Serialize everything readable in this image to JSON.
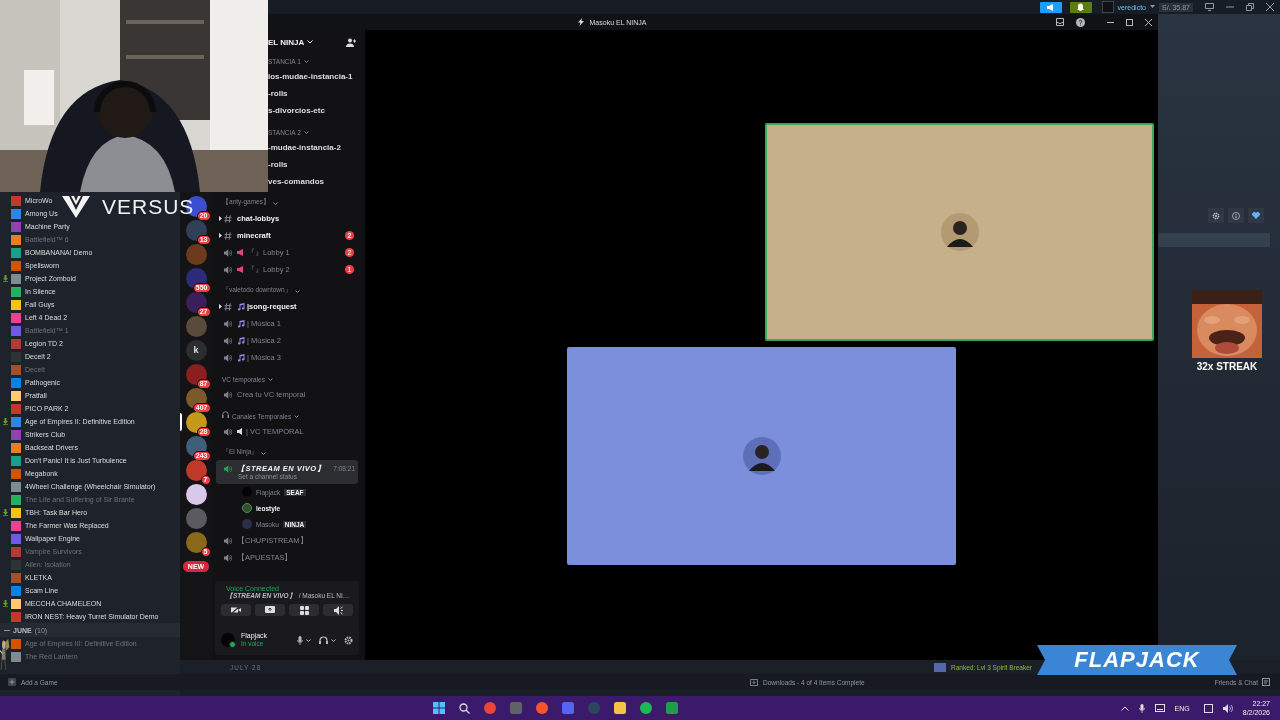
{
  "steam_top": {
    "username": "veredicto",
    "balance": "S/. 35.87"
  },
  "library": {
    "games": [
      {
        "name": "MicroWo",
        "installed": true,
        "update": false
      },
      {
        "name": "Among Us",
        "installed": true,
        "update": false
      },
      {
        "name": "Machine Party",
        "installed": true,
        "update": false
      },
      {
        "name": "Battlefield™ 6",
        "installed": false,
        "update": false
      },
      {
        "name": "BOMBANANA! Demo",
        "installed": true,
        "update": false
      },
      {
        "name": "Spellsworn",
        "installed": true,
        "update": false
      },
      {
        "name": "Project Zomboid",
        "installed": true,
        "update": true
      },
      {
        "name": "In Silence",
        "installed": true,
        "update": false
      },
      {
        "name": "Fall Guys",
        "installed": true,
        "update": false
      },
      {
        "name": "Left 4 Dead 2",
        "installed": true,
        "update": false
      },
      {
        "name": "Battlefield™ 1",
        "installed": false,
        "update": false
      },
      {
        "name": "Legion TD 2",
        "installed": true,
        "update": false
      },
      {
        "name": "Deceit 2",
        "installed": true,
        "update": false
      },
      {
        "name": "Deceit",
        "installed": false,
        "update": false
      },
      {
        "name": "Pathogenic",
        "installed": true,
        "update": false
      },
      {
        "name": "Pratfall",
        "installed": true,
        "update": false
      },
      {
        "name": "PICO PARK 2",
        "installed": true,
        "update": false
      },
      {
        "name": "Age of Empires II: Definitive Edition",
        "installed": true,
        "update": true
      },
      {
        "name": "Strikers Club",
        "installed": true,
        "update": false
      },
      {
        "name": "Backseat Drivers",
        "installed": true,
        "update": false
      },
      {
        "name": "Don't Panic! It is Just Turbulence",
        "installed": true,
        "update": false
      },
      {
        "name": "Megabonk",
        "installed": true,
        "update": false
      },
      {
        "name": "4Wheel Challenge (Wheelchair Simulator)",
        "installed": true,
        "update": false
      },
      {
        "name": "The Life and Suffering of Sir Brante",
        "installed": false,
        "update": false
      },
      {
        "name": "TBH: Task Bar Hero",
        "installed": true,
        "update": true
      },
      {
        "name": "The Farmer Was Replaced",
        "installed": true,
        "update": false
      },
      {
        "name": "Wallpaper Engine",
        "installed": true,
        "update": false
      },
      {
        "name": "Vampire Survivors",
        "installed": false,
        "update": false
      },
      {
        "name": "Alien: Isolation",
        "installed": false,
        "update": false
      },
      {
        "name": "KLETKA",
        "installed": true,
        "update": false
      },
      {
        "name": "Scam Line",
        "installed": true,
        "update": false
      },
      {
        "name": "MECCHA CHAMELEON",
        "installed": true,
        "update": true
      },
      {
        "name": "IRON NEST: Heavy Turret Simulator Demo",
        "installed": true,
        "update": false
      }
    ],
    "section": {
      "label": "JUNE",
      "count": "(10)",
      "expanded": true
    },
    "section_games": [
      {
        "name": "Age of Empires III: Definitive Edition",
        "installed": false,
        "update": false
      },
      {
        "name": "The Red Lantern",
        "installed": false,
        "update": false
      }
    ],
    "add_game": "Add a Game"
  },
  "discord": {
    "title": "Masoku EL NINJA",
    "servers": [
      {
        "kind": "icon",
        "badge": "20",
        "selected": false
      },
      {
        "kind": "icon",
        "badge": "13",
        "selected": false
      },
      {
        "kind": "icon",
        "selected": false
      },
      {
        "kind": "icon",
        "badge": "550",
        "selected": false
      },
      {
        "kind": "icon",
        "badge": "27",
        "selected": false
      },
      {
        "kind": "icon",
        "selected": false
      },
      {
        "kind": "letter",
        "letter": "k",
        "selected": false
      },
      {
        "kind": "icon",
        "badge": "87",
        "selected": false
      },
      {
        "kind": "icon",
        "badge": "407",
        "selected": false
      },
      {
        "kind": "icon",
        "badge": "28",
        "selected": true
      },
      {
        "kind": "icon",
        "badge": "243",
        "selected": false
      },
      {
        "kind": "icon",
        "badge": "7",
        "selected": false
      },
      {
        "kind": "icon",
        "selected": false
      },
      {
        "kind": "icon",
        "selected": false
      },
      {
        "kind": "icon",
        "badge": "5",
        "selected": false
      },
      {
        "kind": "new",
        "letter": "NEW",
        "selected": false
      }
    ],
    "server_name": "EL NINJA",
    "cut_channels": [
      {
        "kind": "category",
        "label": "STANCIA 1"
      },
      {
        "kind": "text",
        "label": "ios-mudae-instancia-1"
      },
      {
        "kind": "text",
        "label": "-rolls"
      },
      {
        "kind": "text",
        "label": "s-divorcios-etc"
      },
      {
        "kind": "category",
        "label": "STANCIA 2"
      },
      {
        "kind": "text",
        "label": "-mudae-instancia-2"
      },
      {
        "kind": "text",
        "label": "-rolls"
      },
      {
        "kind": "text",
        "label": "ves-comandos"
      }
    ],
    "channels": [
      {
        "kind": "category",
        "label": "【anty-games】"
      },
      {
        "kind": "text",
        "label": "chat-lobbys",
        "unread": true,
        "threads": true,
        "selected": false
      },
      {
        "kind": "text",
        "label": "minecraft",
        "unread": true,
        "threads": true,
        "selected": false,
        "badge": "2"
      },
      {
        "kind": "lobbyvoice",
        "label": "『』Lobby 1",
        "unread": false,
        "selected": false,
        "badge": "2"
      },
      {
        "kind": "lobbyvoice",
        "label": "『』Lobby 2",
        "unread": false,
        "selected": false,
        "badge": "1"
      },
      {
        "kind": "category",
        "label": "『valetodo downtown』"
      },
      {
        "kind": "musictext",
        "label": "|song-request",
        "unread": true,
        "threads": true,
        "selected": false
      },
      {
        "kind": "musicvoice",
        "label": "| Música 1",
        "unread": false,
        "selected": false
      },
      {
        "kind": "musicvoice",
        "label": "| Música 2",
        "unread": false,
        "selected": false
      },
      {
        "kind": "musicvoice",
        "label": "| Música 3",
        "unread": false,
        "selected": false
      },
      {
        "kind": "category",
        "label": "VC temporales"
      },
      {
        "kind": "voice",
        "label": "Crea tu VC temporal",
        "unread": false,
        "selected": false
      },
      {
        "kind": "audiocategory",
        "label": "Canales Temporales"
      },
      {
        "kind": "speakervoice",
        "label": "| VC TEMPORAL",
        "unread": false,
        "selected": false
      },
      {
        "kind": "category",
        "label": "『El Ninja』"
      },
      {
        "kind": "voice",
        "label": "【STREAM EN VIVO】",
        "unread": true,
        "selected": true,
        "time": "7:08:21",
        "status": "Set a channel status",
        "members": [
          {
            "name": "Flapjack",
            "tag": "SEAF",
            "speaking": false
          },
          {
            "name": "leostyle",
            "speaking": true
          },
          {
            "name": "Masoku",
            "tag": "NINJA",
            "speaking": false
          }
        ]
      },
      {
        "kind": "voice",
        "label": "【CHUPISTREAM】",
        "unread": false,
        "selected": false
      },
      {
        "kind": "voice",
        "label": "【APUESTAS】",
        "unread": false,
        "selected": false
      }
    ],
    "voice": {
      "status": "Voice Connected",
      "channel": "【STREAM EN VIVO】",
      "server": "/ Masoku EL NI…"
    },
    "user": {
      "name": "Flapjack",
      "status": "In voice"
    },
    "tiles": [
      {
        "speaking": true
      },
      {
        "speaking": false
      }
    ]
  },
  "steam_bottom": {
    "date_header": "JULY 28",
    "friend_status": "Ranked: Lvl 3 Spirit Breaker",
    "downloads": "Downloads - 4 of 4 Items Complete",
    "friends": "Friends & Chat"
  },
  "overlay": {
    "brand": "VERSUS",
    "streak": "32x STREAK",
    "name": "FLAPJACK"
  },
  "taskbar": {
    "language": "ENG",
    "time": "22:27",
    "date": "8/2/2026"
  }
}
